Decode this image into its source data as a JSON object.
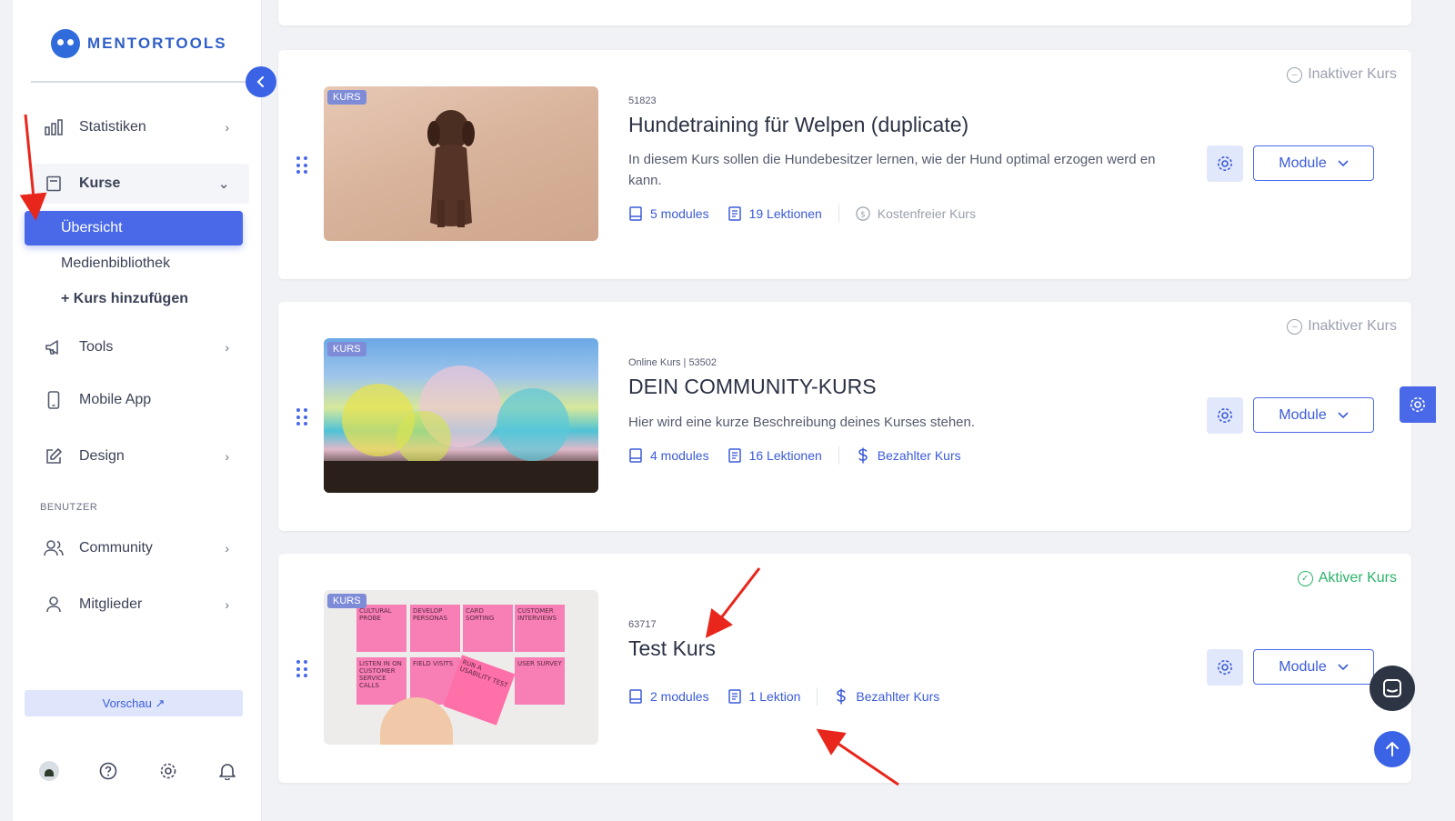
{
  "app": {
    "logo_text": "MENTORTOOLS",
    "brand_color": "#3b63e6"
  },
  "sidebar": {
    "items": [
      {
        "label": "Statistiken",
        "icon": "bar-chart-icon"
      },
      {
        "label": "Kurse",
        "icon": "book-icon"
      },
      {
        "label": "Tools",
        "icon": "megaphone-icon"
      },
      {
        "label": "Mobile App",
        "icon": "phone-icon"
      },
      {
        "label": "Design",
        "icon": "edit-icon"
      },
      {
        "label": "Community",
        "icon": "users-icon"
      },
      {
        "label": "Mitglieder",
        "icon": "user-icon"
      }
    ],
    "kurse_sub": [
      {
        "label": "Übersicht",
        "active": true
      },
      {
        "label": "Medienbibliothek"
      },
      {
        "label": "+ Kurs hinzufügen"
      }
    ],
    "section_benutzer": "BENUTZER",
    "preview_label": "Vorschau ↗",
    "bottom_icons": [
      "avatar",
      "help-icon",
      "settings-icon",
      "bell-icon"
    ]
  },
  "courses": [
    {
      "badge": "KURS",
      "status": "Inaktiver Kurs",
      "status_active": false,
      "meta": "51823",
      "title": "Hundetraining für Welpen (duplicate)",
      "description": "In diesem Kurs sollen die Hundebesitzer lernen, wie der Hund optimal erzogen werd en kann.",
      "modules": "5 modules",
      "lessons": "19 Lektionen",
      "pricing": "Kostenfreier Kurs",
      "module_button": "Module"
    },
    {
      "badge": "KURS",
      "status": "Inaktiver Kurs",
      "status_active": false,
      "meta": "Online Kurs | 53502",
      "title": "DEIN COMMUNITY-KURS",
      "description": "Hier wird eine kurze Beschreibung deines Kurses stehen.",
      "modules": "4 modules",
      "lessons": "16 Lektionen",
      "pricing": "Bezahlter Kurs",
      "module_button": "Module"
    },
    {
      "badge": "KURS",
      "status": "Aktiver Kurs",
      "status_active": true,
      "meta": "63717",
      "title": "Test Kurs",
      "description": "",
      "modules": "2 modules",
      "lessons": "1 Lektion",
      "pricing": "Bezahlter Kurs",
      "module_button": "Module"
    }
  ],
  "sticky_notes": [
    "CULTURAL PROBE",
    "DEVELOP PERSONAS",
    "CARD SORTING",
    "CUSTOMER INTERVIEWS",
    "LISTEN IN ON CUSTOMER SERVICE CALLS",
    "FIELD VISITS",
    "RUN A USABILITY TEST",
    "USER SURVEY"
  ],
  "annotation_color": "#e8261c"
}
